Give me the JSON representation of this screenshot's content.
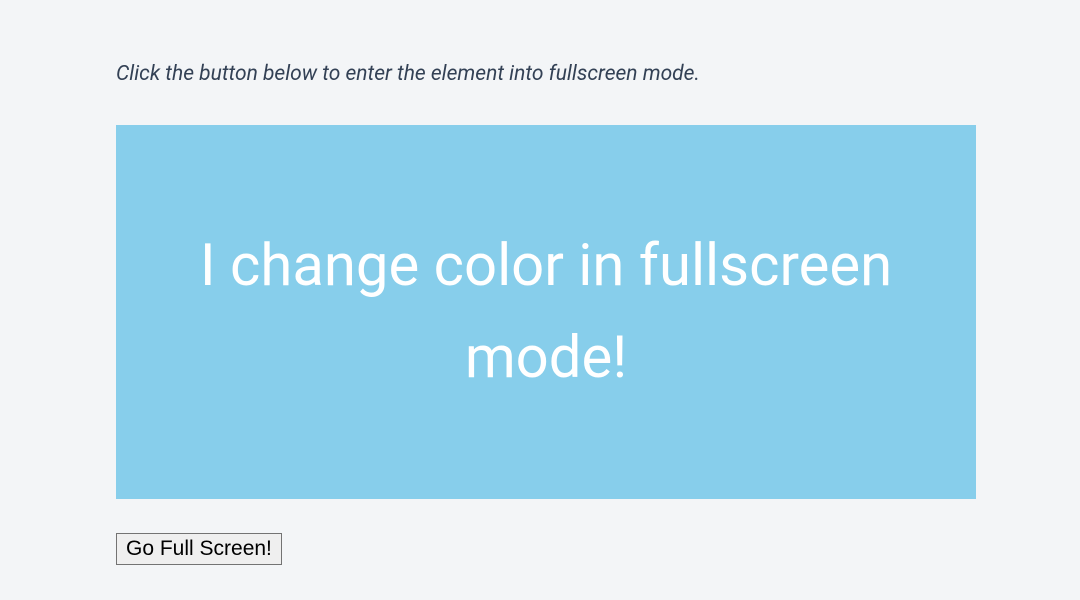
{
  "instruction": "Click the button below to enter the element into fullscreen mode.",
  "demo": {
    "heading": "I change color in fullscreen mode!"
  },
  "button": {
    "label": "Go Full Screen!"
  }
}
